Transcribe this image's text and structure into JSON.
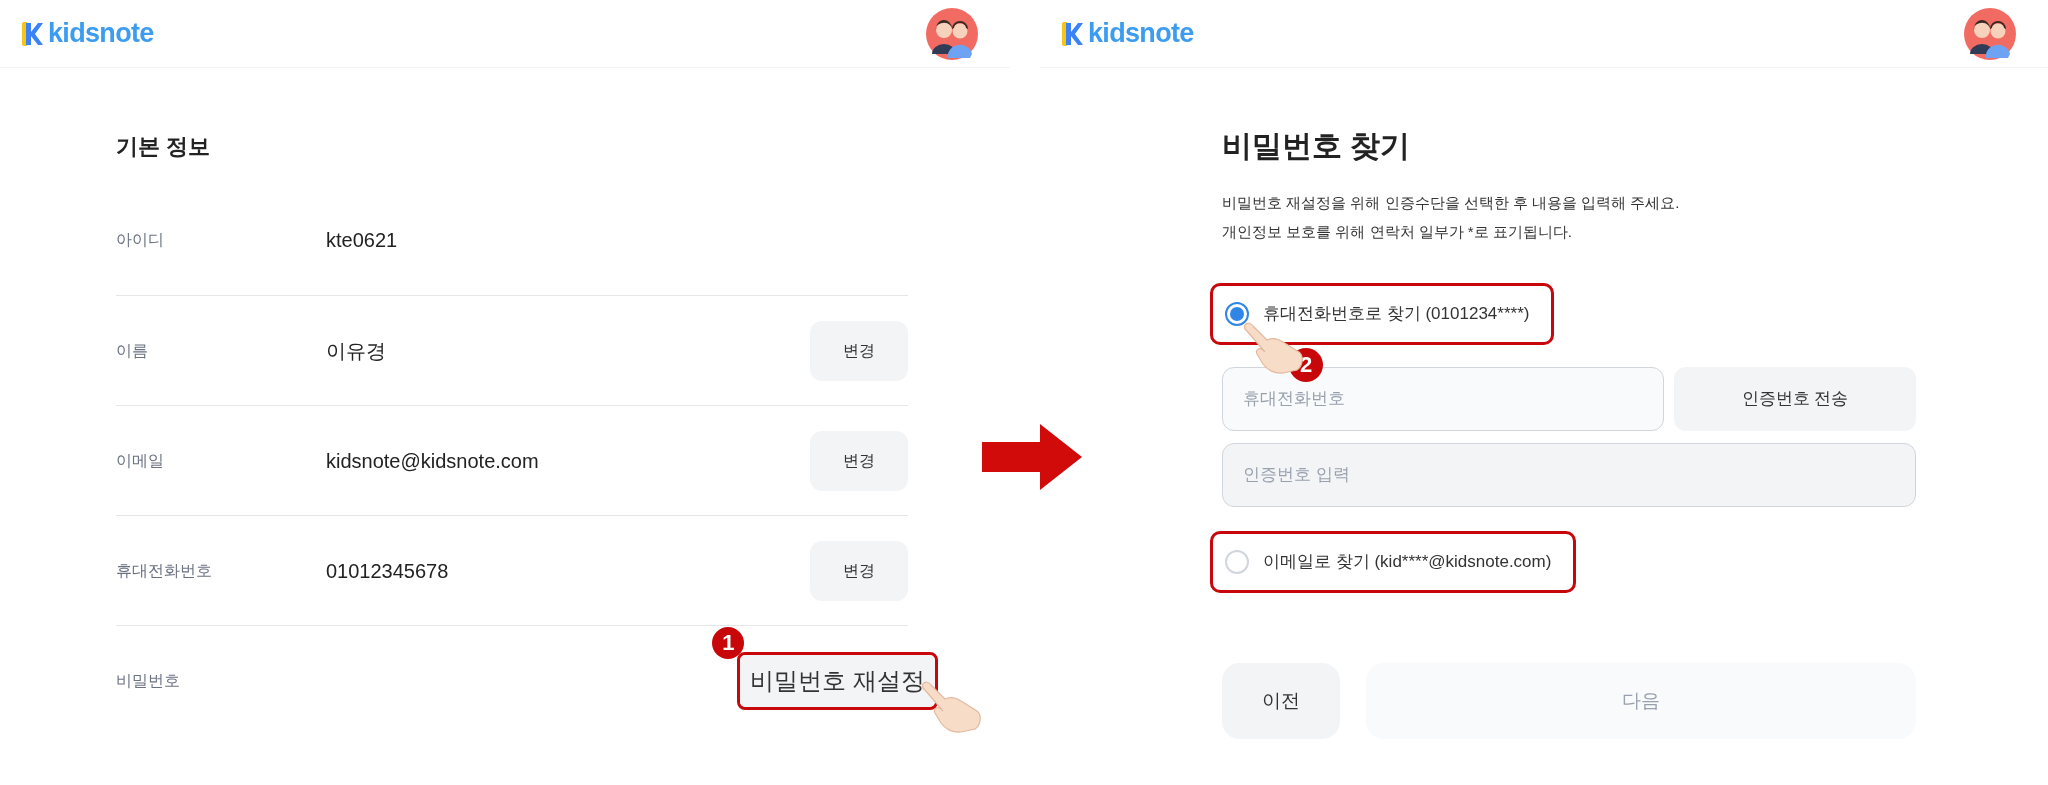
{
  "left": {
    "logo": "kidsnote",
    "section_title": "기본 정보",
    "rows": [
      {
        "label": "아이디",
        "value": "kte0621"
      },
      {
        "label": "이름",
        "value": "이유경",
        "button": "변경"
      },
      {
        "label": "이메일",
        "value": "kidsnote@kidsnote.com",
        "button": "변경"
      },
      {
        "label": "휴대전화번호",
        "value": "01012345678",
        "button": "변경"
      },
      {
        "label": "비밀번호",
        "button": "비밀번호 재설정",
        "highlighted": true,
        "step": "1"
      }
    ]
  },
  "right": {
    "logo": "kidsnote",
    "title": "비밀번호 찾기",
    "description": [
      "비밀번호 재설정을 위해 인증수단을 선택한 후 내용을 입력해 주세요.",
      "개인정보 보호를 위해 연락처 일부가 *로 표기됩니다."
    ],
    "options": [
      {
        "label": "휴대전화번호로 찾기 (0101234****)",
        "selected": true,
        "highlighted": true,
        "step": "2"
      },
      {
        "label": "이메일로 찾기 (kid****@kidsnote.com)",
        "selected": false,
        "highlighted": true
      }
    ],
    "phone_field": {
      "placeholder": "휴대전화번호"
    },
    "send_button": "인증번호 전송",
    "code_field": {
      "placeholder": "인증번호 입력"
    },
    "buttons": [
      {
        "label": "이전",
        "disabled": false
      },
      {
        "label": "다음",
        "disabled": true
      }
    ]
  }
}
